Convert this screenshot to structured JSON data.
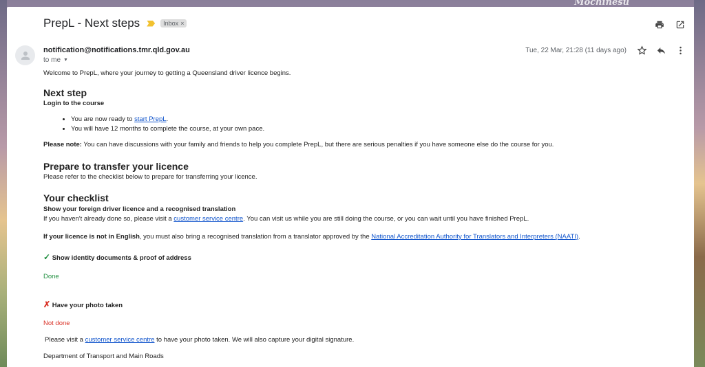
{
  "watermark": "Mochinesu",
  "email": {
    "subject": "PrepL - Next steps",
    "label": "Inbox",
    "label_remove": "×",
    "sender": "notification@notifications.tmr.qld.gov.au",
    "to": "to me",
    "date": "Tue, 22 Mar, 21:28 (11 days ago)"
  },
  "icons": {
    "print": "print-icon",
    "open_new": "open-in-new-window-icon",
    "star": "star-icon",
    "reply": "reply-icon",
    "more": "more-vertical-icon",
    "avatar": "person-icon"
  },
  "content": {
    "welcome": "Welcome to PrepL, where your journey to getting a Queensland driver licence begins.",
    "next_step_heading": "Next step",
    "login_heading": "Login to the course",
    "bullet1_prefix": "You are now ready to ",
    "bullet1_link": "start PrepL",
    "bullet1_suffix": ".",
    "bullet2": "You will have 12 months to complete the course, at your own pace.",
    "note_label": "Please note:",
    "note_text": " You can have discussions with your family and friends to help you complete PrepL, but there are serious penalties if you have someone else do the course for you.",
    "transfer_heading": "Prepare to transfer your licence",
    "transfer_text": "Please refer to the checklist below to prepare for transferring your licence.",
    "checklist_heading": "Your checklist",
    "foreign_heading": "Show your foreign driver licence and a recognised translation",
    "foreign_prefix": "If you haven't already done so, please visit a ",
    "foreign_link": "customer service centre",
    "foreign_suffix": ". You can visit us while you are still doing the course, or you can wait until you have finished PrepL.",
    "english_bold": "If your licence is not in English",
    "english_text": ", you must also bring a recognised translation from a translator approved by the ",
    "naati_link": "National Accreditation Authority for Translators and Interpreters (NAATI)",
    "english_end": ".",
    "identity_mark": "✓",
    "identity_heading": "Show identity documents & proof of address",
    "identity_status": "Done",
    "photo_mark": "✗",
    "photo_heading": "Have your photo taken",
    "photo_status": "Not done",
    "photo_prefix": "Please visit a ",
    "photo_link": "customer service centre",
    "photo_suffix": " to have your photo taken. We will also capture your digital signature.",
    "signoff": "Department of Transport and Main Roads"
  },
  "colors": {
    "link": "#1155cc",
    "done": "#1e8e3e",
    "not_done": "#d93025",
    "importance": "#f2c230"
  }
}
